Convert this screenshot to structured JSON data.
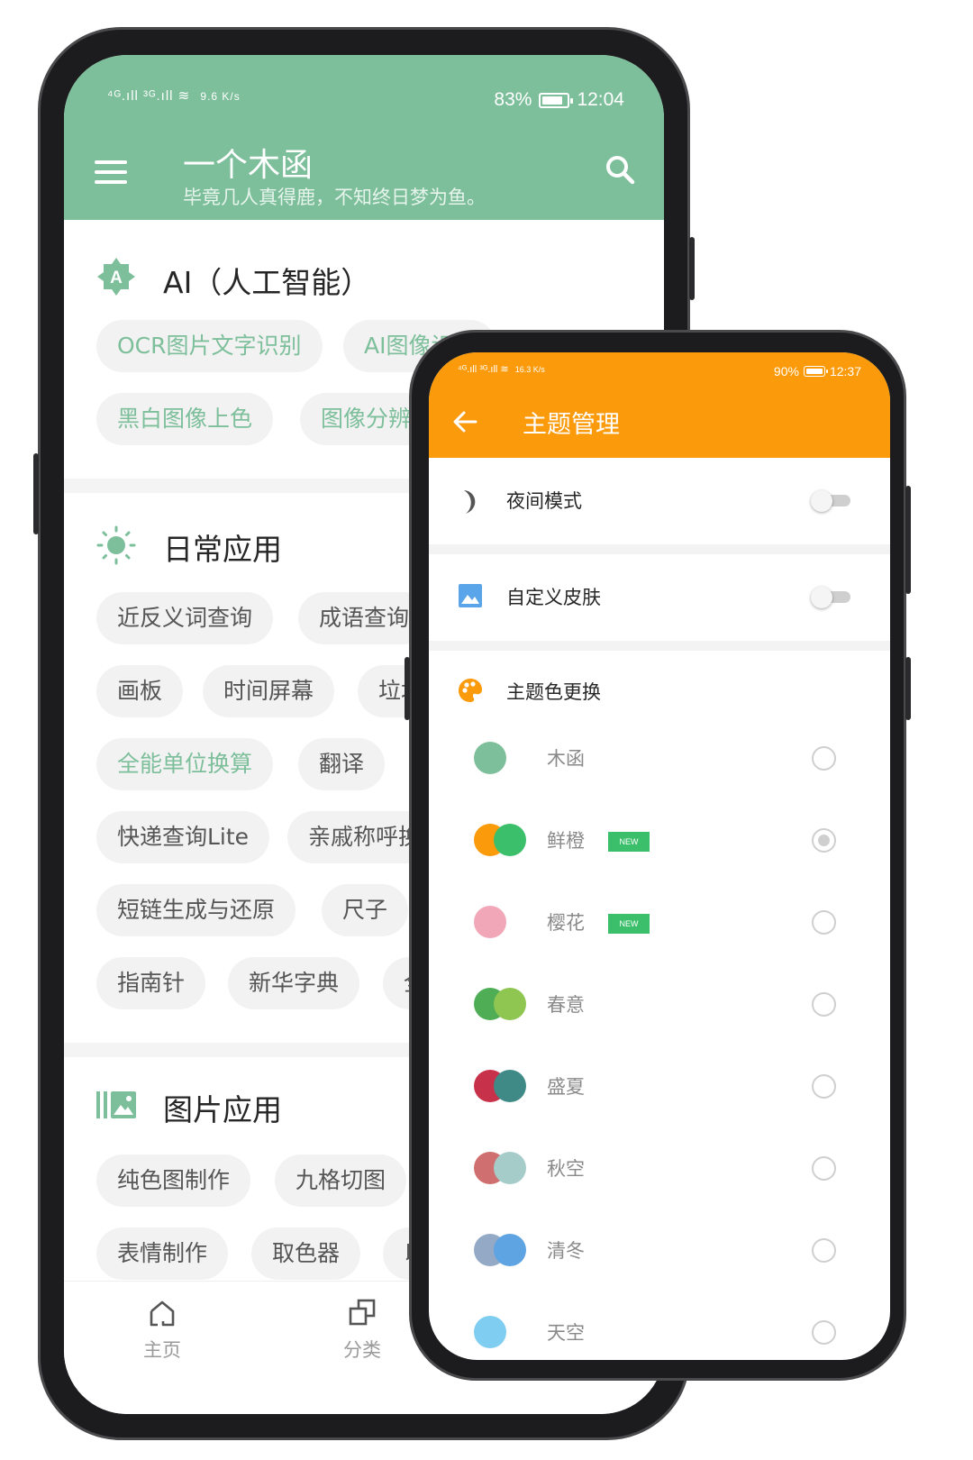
{
  "phone_a": {
    "status": {
      "signal_left": "⁴ᴳ.ıll ³ᴳ.ıll ≋",
      "speed": "9.6 K/s",
      "battery": "83%",
      "time": "12:04"
    },
    "header": {
      "title": "一个木函",
      "subtitle": "毕竟几人真得鹿，不知终日梦为鱼。"
    },
    "sections": [
      {
        "title": "AI（人工智能）",
        "chips": [
          "OCR图片文字识别",
          "AI图像识别",
          "黑白图像上色",
          "图像分辨"
        ]
      },
      {
        "title": "日常应用",
        "chips": [
          "近反义词查询",
          "成语查询",
          "画板",
          "时间屏幕",
          "垃圾",
          "全能单位换算",
          "翻译",
          "快递查询Lite",
          "亲戚称呼换",
          "短链生成与还原",
          "尺子",
          "指南针",
          "新华字典",
          "全"
        ]
      },
      {
        "title": "图片应用",
        "chips": [
          "纯色图制作",
          "九格切图",
          "表情制作",
          "取色器",
          "以"
        ]
      }
    ],
    "nav": {
      "home": "主页",
      "category": "分类"
    },
    "colors": {
      "primary": "#7dbf9b"
    }
  },
  "phone_b": {
    "status": {
      "signal_left": "⁴ᴳ.ıll ³ᴳ.ıll ≋",
      "speed": "16.3 K/s",
      "battery": "90%",
      "time": "12:37"
    },
    "header": {
      "title": "主题管理"
    },
    "night_mode": {
      "label": "夜间模式",
      "enabled": false
    },
    "custom_skin": {
      "label": "自定义皮肤",
      "enabled": false
    },
    "theme_section": {
      "label": "主题色更换"
    },
    "new_badge": "NEW",
    "themes": [
      {
        "name": "木函",
        "colors": [
          "#7dbf9b"
        ],
        "is_new": false,
        "selected": false
      },
      {
        "name": "鲜橙",
        "colors": [
          "#fb9a0a",
          "#3cbf6b"
        ],
        "is_new": true,
        "selected": true
      },
      {
        "name": "樱花",
        "colors": [
          "#f2a7b9"
        ],
        "is_new": true,
        "selected": false
      },
      {
        "name": "春意",
        "colors": [
          "#4fae55",
          "#8fc651"
        ],
        "is_new": false,
        "selected": false
      },
      {
        "name": "盛夏",
        "colors": [
          "#c7314a",
          "#3f8a86"
        ],
        "is_new": false,
        "selected": false
      },
      {
        "name": "秋空",
        "colors": [
          "#cf6f6f",
          "#a5ccc9"
        ],
        "is_new": false,
        "selected": false
      },
      {
        "name": "清冬",
        "colors": [
          "#94a9c6",
          "#5ea3e2"
        ],
        "is_new": false,
        "selected": false
      },
      {
        "name": "天空",
        "colors": [
          "#7fcdf1"
        ],
        "is_new": false,
        "selected": false
      }
    ],
    "colors": {
      "primary": "#fb9a0a"
    }
  }
}
